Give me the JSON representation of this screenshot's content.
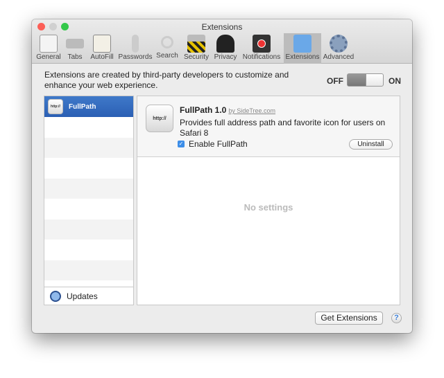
{
  "window": {
    "title": "Extensions"
  },
  "toolbar": [
    {
      "label": "General",
      "icon": "general-icon"
    },
    {
      "label": "Tabs",
      "icon": "tabs-icon"
    },
    {
      "label": "AutoFill",
      "icon": "autofill-icon"
    },
    {
      "label": "Passwords",
      "icon": "key-icon"
    },
    {
      "label": "Search",
      "icon": "search-icon"
    },
    {
      "label": "Security",
      "icon": "lock-icon"
    },
    {
      "label": "Privacy",
      "icon": "person-icon"
    },
    {
      "label": "Notifications",
      "icon": "notifications-icon"
    },
    {
      "label": "Extensions",
      "icon": "puzzle-icon",
      "selected": true
    },
    {
      "label": "Advanced",
      "icon": "gear-icon"
    }
  ],
  "intro": "Extensions are created by third-party developers to customize and enhance your web experience.",
  "toggle": {
    "off": "OFF",
    "on": "ON",
    "state": "on"
  },
  "list": {
    "items": [
      {
        "name": "FullPath",
        "icon_text": "http://"
      }
    ],
    "updates": "Updates"
  },
  "detail": {
    "name": "FullPath 1.0",
    "by": "by SideTree.com",
    "icon_text": "http://",
    "description": "Provides full address path and favorite icon for users on Safari 8",
    "enable_label": "Enable FullPath",
    "enabled": true,
    "uninstall": "Uninstall",
    "no_settings": "No settings"
  },
  "footer": {
    "get_extensions": "Get Extensions",
    "help": "?"
  }
}
